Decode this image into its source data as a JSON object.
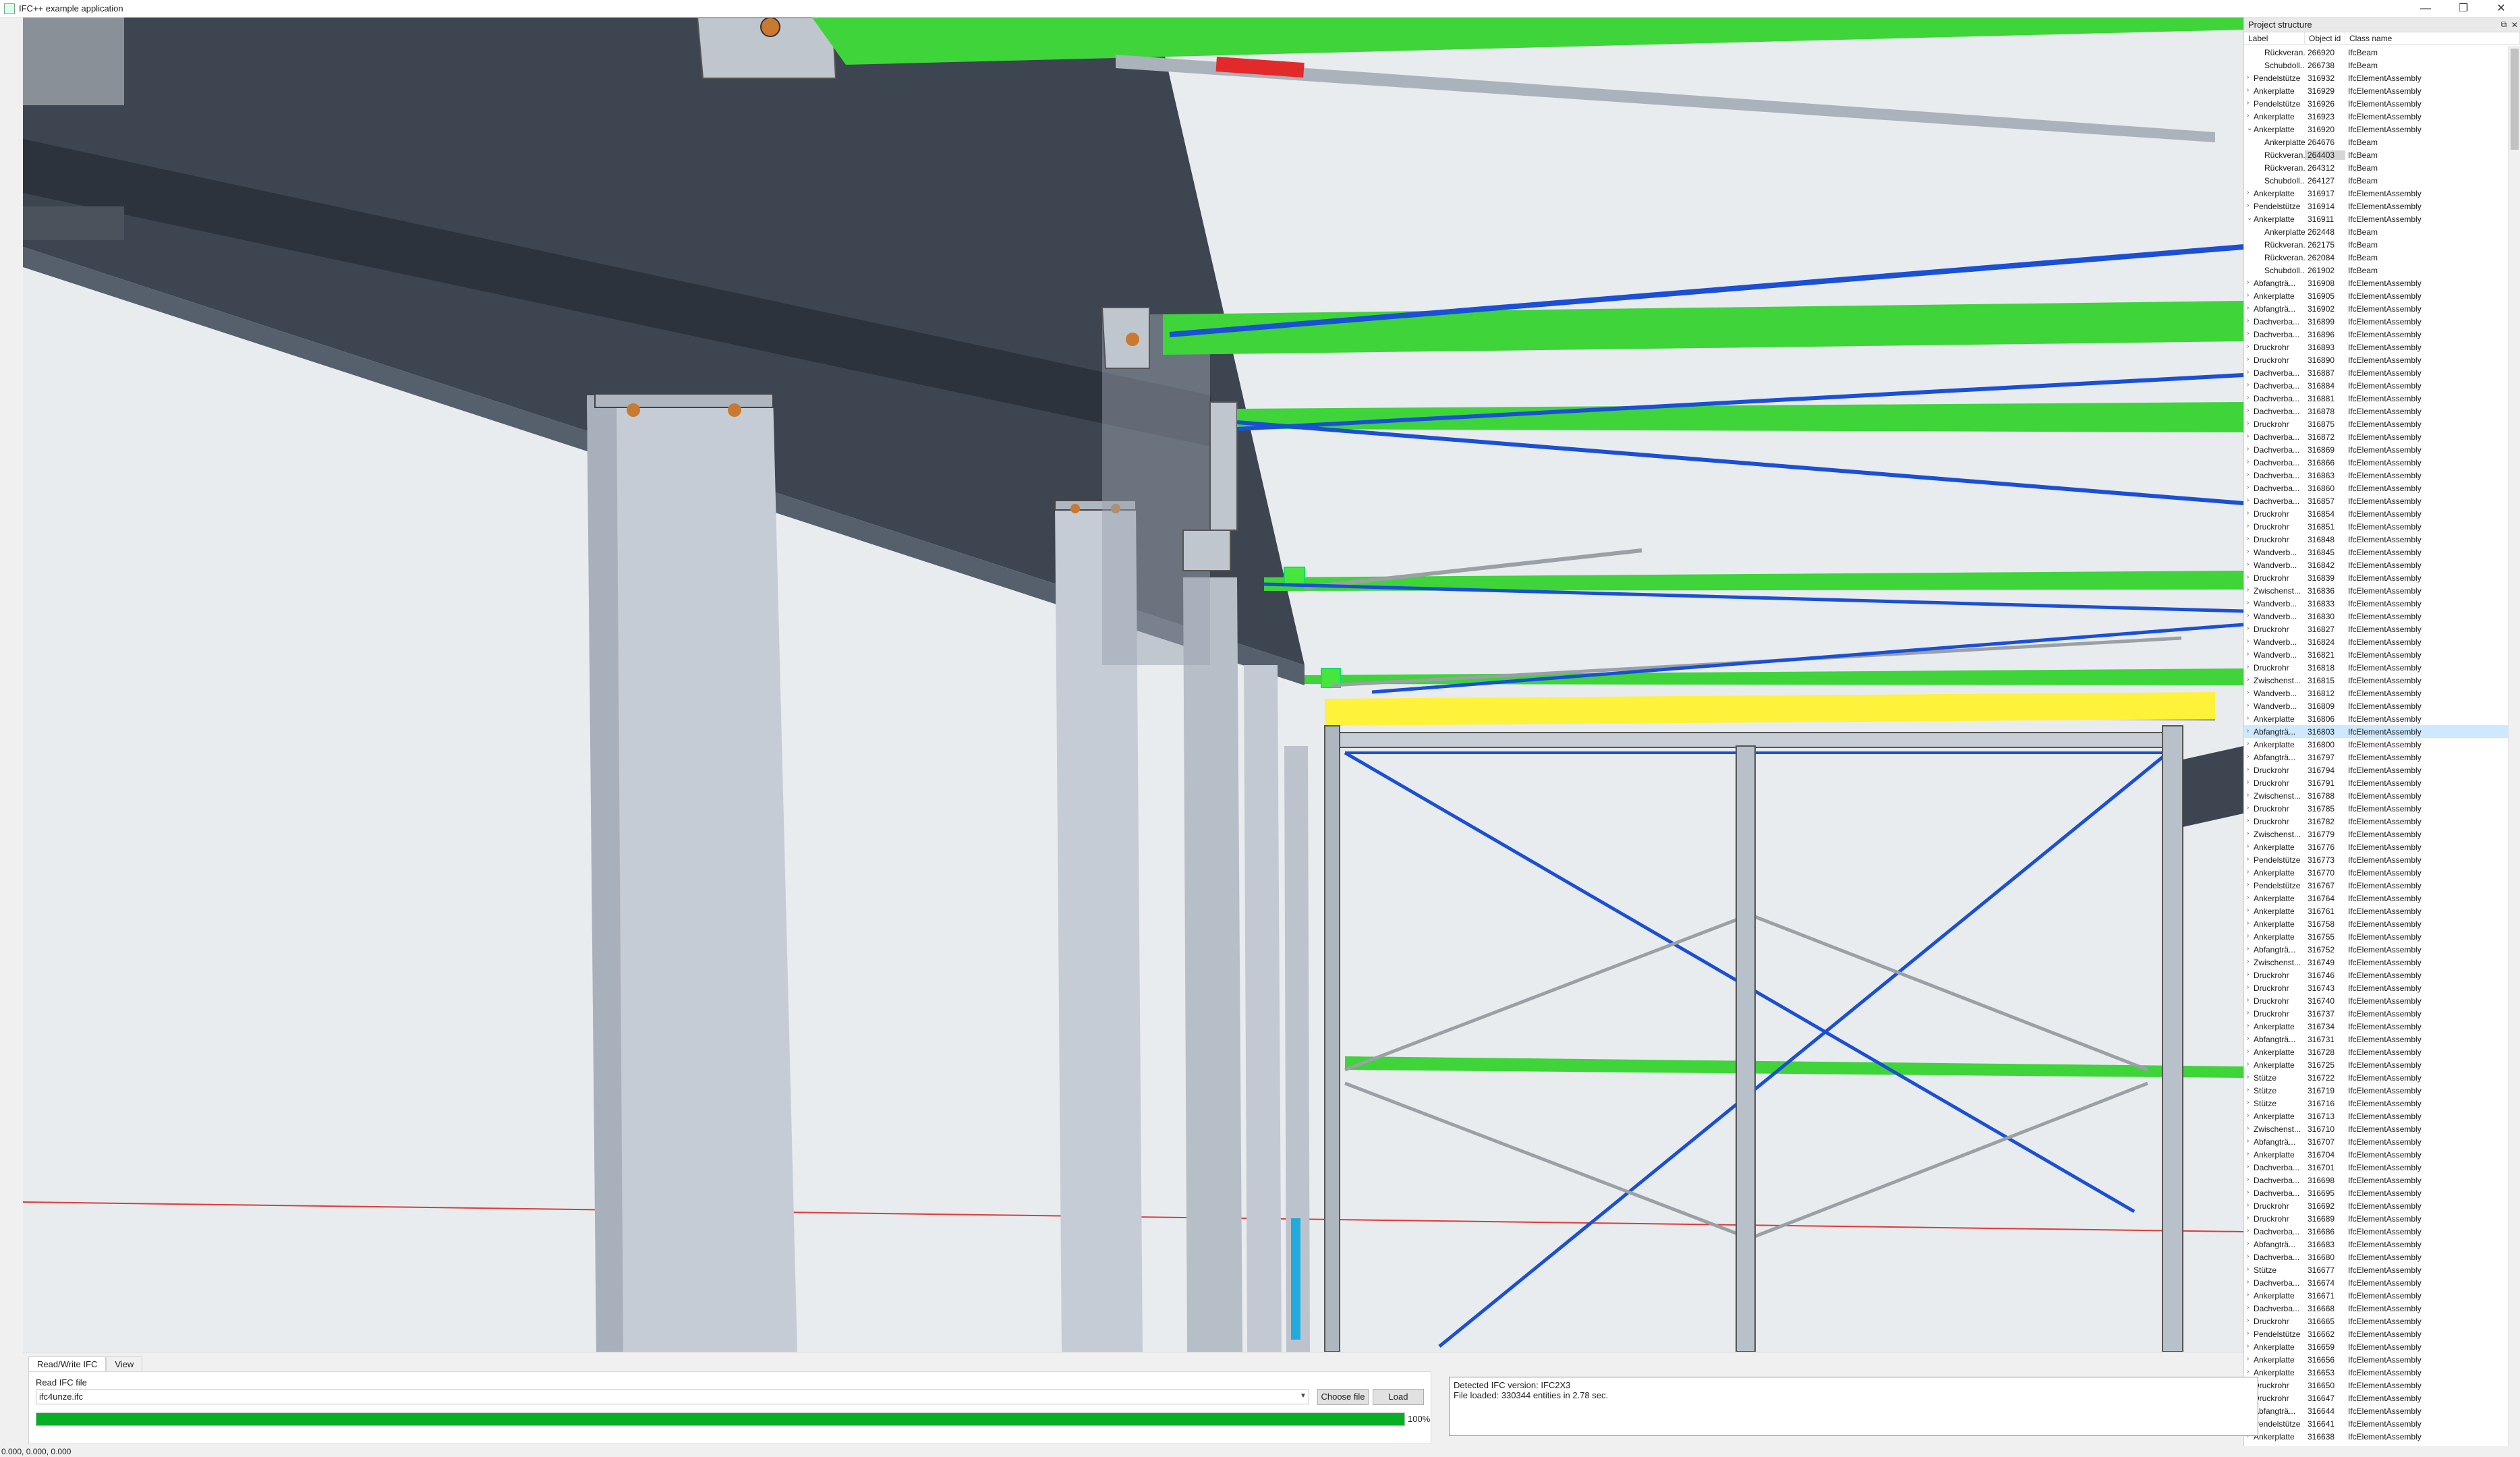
{
  "window": {
    "title": "IFC++ example application",
    "buttons": [
      "—",
      "❐",
      "✕"
    ]
  },
  "project_structure": {
    "title": "Project structure",
    "columns": [
      "Label",
      "Object id",
      "Class name"
    ],
    "rows": [
      {
        "label": "Rückveran...",
        "id": "266920",
        "cls": "IfcBeam",
        "child": true
      },
      {
        "label": "Schubdoll...",
        "id": "266738",
        "cls": "IfcBeam",
        "child": true
      },
      {
        "label": "Pendelstütze",
        "id": "316932",
        "cls": "IfcElementAssembly"
      },
      {
        "label": "Ankerplatte",
        "id": "316929",
        "cls": "IfcElementAssembly"
      },
      {
        "label": "Pendelstütze",
        "id": "316926",
        "cls": "IfcElementAssembly"
      },
      {
        "label": "Ankerplatte",
        "id": "316923",
        "cls": "IfcElementAssembly"
      },
      {
        "label": "Ankerplatte",
        "id": "316920",
        "cls": "IfcElementAssembly",
        "open": true
      },
      {
        "label": "Ankerplatte",
        "id": "264676",
        "cls": "IfcBeam",
        "child": true
      },
      {
        "label": "Rückveran...",
        "id": "264403",
        "cls": "IfcBeam",
        "child": true,
        "hl": true
      },
      {
        "label": "Rückveran...",
        "id": "264312",
        "cls": "IfcBeam",
        "child": true
      },
      {
        "label": "Schubdoll...",
        "id": "264127",
        "cls": "IfcBeam",
        "child": true
      },
      {
        "label": "Ankerplatte",
        "id": "316917",
        "cls": "IfcElementAssembly"
      },
      {
        "label": "Pendelstütze",
        "id": "316914",
        "cls": "IfcElementAssembly"
      },
      {
        "label": "Ankerplatte",
        "id": "316911",
        "cls": "IfcElementAssembly",
        "open": true
      },
      {
        "label": "Ankerplatte",
        "id": "262448",
        "cls": "IfcBeam",
        "child": true
      },
      {
        "label": "Rückveran...",
        "id": "262175",
        "cls": "IfcBeam",
        "child": true
      },
      {
        "label": "Rückveran...",
        "id": "262084",
        "cls": "IfcBeam",
        "child": true
      },
      {
        "label": "Schubdoll...",
        "id": "261902",
        "cls": "IfcBeam",
        "child": true
      },
      {
        "label": "Abfangträ...",
        "id": "316908",
        "cls": "IfcElementAssembly"
      },
      {
        "label": "Ankerplatte",
        "id": "316905",
        "cls": "IfcElementAssembly"
      },
      {
        "label": "Abfangträ...",
        "id": "316902",
        "cls": "IfcElementAssembly"
      },
      {
        "label": "Dachverba...",
        "id": "316899",
        "cls": "IfcElementAssembly"
      },
      {
        "label": "Dachverba...",
        "id": "316896",
        "cls": "IfcElementAssembly"
      },
      {
        "label": "Druckrohr",
        "id": "316893",
        "cls": "IfcElementAssembly"
      },
      {
        "label": "Druckrohr",
        "id": "316890",
        "cls": "IfcElementAssembly"
      },
      {
        "label": "Dachverba...",
        "id": "316887",
        "cls": "IfcElementAssembly"
      },
      {
        "label": "Dachverba...",
        "id": "316884",
        "cls": "IfcElementAssembly"
      },
      {
        "label": "Dachverba...",
        "id": "316881",
        "cls": "IfcElementAssembly"
      },
      {
        "label": "Dachverba...",
        "id": "316878",
        "cls": "IfcElementAssembly"
      },
      {
        "label": "Druckrohr",
        "id": "316875",
        "cls": "IfcElementAssembly"
      },
      {
        "label": "Dachverba...",
        "id": "316872",
        "cls": "IfcElementAssembly"
      },
      {
        "label": "Dachverba...",
        "id": "316869",
        "cls": "IfcElementAssembly"
      },
      {
        "label": "Dachverba...",
        "id": "316866",
        "cls": "IfcElementAssembly"
      },
      {
        "label": "Dachverba...",
        "id": "316863",
        "cls": "IfcElementAssembly"
      },
      {
        "label": "Dachverba...",
        "id": "316860",
        "cls": "IfcElementAssembly"
      },
      {
        "label": "Dachverba...",
        "id": "316857",
        "cls": "IfcElementAssembly"
      },
      {
        "label": "Druckrohr",
        "id": "316854",
        "cls": "IfcElementAssembly"
      },
      {
        "label": "Druckrohr",
        "id": "316851",
        "cls": "IfcElementAssembly"
      },
      {
        "label": "Druckrohr",
        "id": "316848",
        "cls": "IfcElementAssembly"
      },
      {
        "label": "Wandverb...",
        "id": "316845",
        "cls": "IfcElementAssembly"
      },
      {
        "label": "Wandverb...",
        "id": "316842",
        "cls": "IfcElementAssembly"
      },
      {
        "label": "Druckrohr",
        "id": "316839",
        "cls": "IfcElementAssembly"
      },
      {
        "label": "Zwischenst...",
        "id": "316836",
        "cls": "IfcElementAssembly"
      },
      {
        "label": "Wandverb...",
        "id": "316833",
        "cls": "IfcElementAssembly"
      },
      {
        "label": "Wandverb...",
        "id": "316830",
        "cls": "IfcElementAssembly"
      },
      {
        "label": "Druckrohr",
        "id": "316827",
        "cls": "IfcElementAssembly"
      },
      {
        "label": "Wandverb...",
        "id": "316824",
        "cls": "IfcElementAssembly"
      },
      {
        "label": "Wandverb...",
        "id": "316821",
        "cls": "IfcElementAssembly"
      },
      {
        "label": "Druckrohr",
        "id": "316818",
        "cls": "IfcElementAssembly"
      },
      {
        "label": "Zwischenst...",
        "id": "316815",
        "cls": "IfcElementAssembly"
      },
      {
        "label": "Wandverb...",
        "id": "316812",
        "cls": "IfcElementAssembly"
      },
      {
        "label": "Wandverb...",
        "id": "316809",
        "cls": "IfcElementAssembly"
      },
      {
        "label": "Ankerplatte",
        "id": "316806",
        "cls": "IfcElementAssembly"
      },
      {
        "label": "Abfangträ...",
        "id": "316803",
        "cls": "IfcElementAssembly",
        "sel": true
      },
      {
        "label": "Ankerplatte",
        "id": "316800",
        "cls": "IfcElementAssembly"
      },
      {
        "label": "Abfangträ...",
        "id": "316797",
        "cls": "IfcElementAssembly"
      },
      {
        "label": "Druckrohr",
        "id": "316794",
        "cls": "IfcElementAssembly"
      },
      {
        "label": "Druckrohr",
        "id": "316791",
        "cls": "IfcElementAssembly"
      },
      {
        "label": "Zwischenst...",
        "id": "316788",
        "cls": "IfcElementAssembly"
      },
      {
        "label": "Druckrohr",
        "id": "316785",
        "cls": "IfcElementAssembly"
      },
      {
        "label": "Druckrohr",
        "id": "316782",
        "cls": "IfcElementAssembly"
      },
      {
        "label": "Zwischenst...",
        "id": "316779",
        "cls": "IfcElementAssembly"
      },
      {
        "label": "Ankerplatte",
        "id": "316776",
        "cls": "IfcElementAssembly"
      },
      {
        "label": "Pendelstütze",
        "id": "316773",
        "cls": "IfcElementAssembly"
      },
      {
        "label": "Ankerplatte",
        "id": "316770",
        "cls": "IfcElementAssembly"
      },
      {
        "label": "Pendelstütze",
        "id": "316767",
        "cls": "IfcElementAssembly"
      },
      {
        "label": "Ankerplatte",
        "id": "316764",
        "cls": "IfcElementAssembly"
      },
      {
        "label": "Ankerplatte",
        "id": "316761",
        "cls": "IfcElementAssembly"
      },
      {
        "label": "Ankerplatte",
        "id": "316758",
        "cls": "IfcElementAssembly"
      },
      {
        "label": "Ankerplatte",
        "id": "316755",
        "cls": "IfcElementAssembly"
      },
      {
        "label": "Abfangträ...",
        "id": "316752",
        "cls": "IfcElementAssembly"
      },
      {
        "label": "Zwischenst...",
        "id": "316749",
        "cls": "IfcElementAssembly"
      },
      {
        "label": "Druckrohr",
        "id": "316746",
        "cls": "IfcElementAssembly"
      },
      {
        "label": "Druckrohr",
        "id": "316743",
        "cls": "IfcElementAssembly"
      },
      {
        "label": "Druckrohr",
        "id": "316740",
        "cls": "IfcElementAssembly"
      },
      {
        "label": "Druckrohr",
        "id": "316737",
        "cls": "IfcElementAssembly"
      },
      {
        "label": "Ankerplatte",
        "id": "316734",
        "cls": "IfcElementAssembly"
      },
      {
        "label": "Abfangträ...",
        "id": "316731",
        "cls": "IfcElementAssembly"
      },
      {
        "label": "Ankerplatte",
        "id": "316728",
        "cls": "IfcElementAssembly"
      },
      {
        "label": "Ankerplatte",
        "id": "316725",
        "cls": "IfcElementAssembly"
      },
      {
        "label": "Stütze",
        "id": "316722",
        "cls": "IfcElementAssembly"
      },
      {
        "label": "Stütze",
        "id": "316719",
        "cls": "IfcElementAssembly"
      },
      {
        "label": "Stütze",
        "id": "316716",
        "cls": "IfcElementAssembly"
      },
      {
        "label": "Ankerplatte",
        "id": "316713",
        "cls": "IfcElementAssembly"
      },
      {
        "label": "Zwischenst...",
        "id": "316710",
        "cls": "IfcElementAssembly"
      },
      {
        "label": "Abfangträ...",
        "id": "316707",
        "cls": "IfcElementAssembly"
      },
      {
        "label": "Ankerplatte",
        "id": "316704",
        "cls": "IfcElementAssembly"
      },
      {
        "label": "Dachverba...",
        "id": "316701",
        "cls": "IfcElementAssembly"
      },
      {
        "label": "Dachverba...",
        "id": "316698",
        "cls": "IfcElementAssembly"
      },
      {
        "label": "Dachverba...",
        "id": "316695",
        "cls": "IfcElementAssembly"
      },
      {
        "label": "Druckrohr",
        "id": "316692",
        "cls": "IfcElementAssembly"
      },
      {
        "label": "Druckrohr",
        "id": "316689",
        "cls": "IfcElementAssembly"
      },
      {
        "label": "Dachverba...",
        "id": "316686",
        "cls": "IfcElementAssembly"
      },
      {
        "label": "Abfangträ...",
        "id": "316683",
        "cls": "IfcElementAssembly"
      },
      {
        "label": "Dachverba...",
        "id": "316680",
        "cls": "IfcElementAssembly"
      },
      {
        "label": "Stütze",
        "id": "316677",
        "cls": "IfcElementAssembly"
      },
      {
        "label": "Dachverba...",
        "id": "316674",
        "cls": "IfcElementAssembly"
      },
      {
        "label": "Ankerplatte",
        "id": "316671",
        "cls": "IfcElementAssembly"
      },
      {
        "label": "Dachverba...",
        "id": "316668",
        "cls": "IfcElementAssembly"
      },
      {
        "label": "Druckrohr",
        "id": "316665",
        "cls": "IfcElementAssembly"
      },
      {
        "label": "Pendelstütze",
        "id": "316662",
        "cls": "IfcElementAssembly"
      },
      {
        "label": "Ankerplatte",
        "id": "316659",
        "cls": "IfcElementAssembly"
      },
      {
        "label": "Ankerplatte",
        "id": "316656",
        "cls": "IfcElementAssembly"
      },
      {
        "label": "Ankerplatte",
        "id": "316653",
        "cls": "IfcElementAssembly"
      },
      {
        "label": "Druckrohr",
        "id": "316650",
        "cls": "IfcElementAssembly"
      },
      {
        "label": "Druckrohr",
        "id": "316647",
        "cls": "IfcElementAssembly"
      },
      {
        "label": "Abfangträ...",
        "id": "316644",
        "cls": "IfcElementAssembly"
      },
      {
        "label": "Pendelstütze",
        "id": "316641",
        "cls": "IfcElementAssembly"
      },
      {
        "label": "Ankerplatte",
        "id": "316638",
        "cls": "IfcElementAssembly"
      }
    ]
  },
  "bottom": {
    "tabs": [
      "Read/Write IFC",
      "View"
    ],
    "read_label": "Read IFC file",
    "file_value": "ifc4unze.ifc",
    "choose_label": "Choose file",
    "load_label": "Load",
    "progress_value": 1.0,
    "progress_text": "100%",
    "log_lines": [
      "Detected IFC version: IFC2X3",
      "File loaded: 330344 entities in 2.78 sec."
    ]
  },
  "status": {
    "coords": "0.000, 0.000, 0.000"
  },
  "colors": {
    "beam_dark": "#3d4550",
    "column_light": "#c5ccd6",
    "pipe_green": "#3ed43a",
    "brace_blue": "#1a4fd6",
    "highlight_yellow": "#fff23a",
    "progress_green": "#06b025"
  }
}
